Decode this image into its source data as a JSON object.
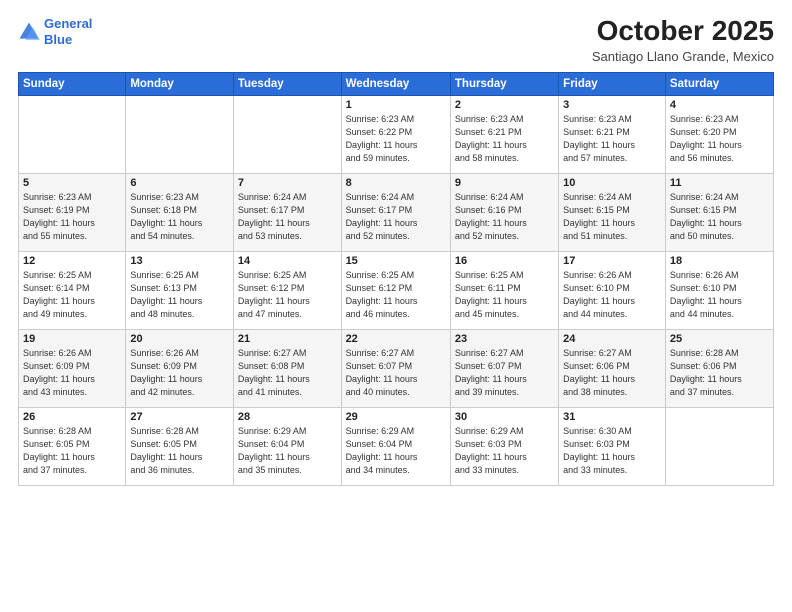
{
  "header": {
    "logo_line1": "General",
    "logo_line2": "Blue",
    "month_title": "October 2025",
    "location": "Santiago Llano Grande, Mexico"
  },
  "weekdays": [
    "Sunday",
    "Monday",
    "Tuesday",
    "Wednesday",
    "Thursday",
    "Friday",
    "Saturday"
  ],
  "weeks": [
    [
      {
        "day": "",
        "info": ""
      },
      {
        "day": "",
        "info": ""
      },
      {
        "day": "",
        "info": ""
      },
      {
        "day": "1",
        "info": "Sunrise: 6:23 AM\nSunset: 6:22 PM\nDaylight: 11 hours\nand 59 minutes."
      },
      {
        "day": "2",
        "info": "Sunrise: 6:23 AM\nSunset: 6:21 PM\nDaylight: 11 hours\nand 58 minutes."
      },
      {
        "day": "3",
        "info": "Sunrise: 6:23 AM\nSunset: 6:21 PM\nDaylight: 11 hours\nand 57 minutes."
      },
      {
        "day": "4",
        "info": "Sunrise: 6:23 AM\nSunset: 6:20 PM\nDaylight: 11 hours\nand 56 minutes."
      }
    ],
    [
      {
        "day": "5",
        "info": "Sunrise: 6:23 AM\nSunset: 6:19 PM\nDaylight: 11 hours\nand 55 minutes."
      },
      {
        "day": "6",
        "info": "Sunrise: 6:23 AM\nSunset: 6:18 PM\nDaylight: 11 hours\nand 54 minutes."
      },
      {
        "day": "7",
        "info": "Sunrise: 6:24 AM\nSunset: 6:17 PM\nDaylight: 11 hours\nand 53 minutes."
      },
      {
        "day": "8",
        "info": "Sunrise: 6:24 AM\nSunset: 6:17 PM\nDaylight: 11 hours\nand 52 minutes."
      },
      {
        "day": "9",
        "info": "Sunrise: 6:24 AM\nSunset: 6:16 PM\nDaylight: 11 hours\nand 52 minutes."
      },
      {
        "day": "10",
        "info": "Sunrise: 6:24 AM\nSunset: 6:15 PM\nDaylight: 11 hours\nand 51 minutes."
      },
      {
        "day": "11",
        "info": "Sunrise: 6:24 AM\nSunset: 6:15 PM\nDaylight: 11 hours\nand 50 minutes."
      }
    ],
    [
      {
        "day": "12",
        "info": "Sunrise: 6:25 AM\nSunset: 6:14 PM\nDaylight: 11 hours\nand 49 minutes."
      },
      {
        "day": "13",
        "info": "Sunrise: 6:25 AM\nSunset: 6:13 PM\nDaylight: 11 hours\nand 48 minutes."
      },
      {
        "day": "14",
        "info": "Sunrise: 6:25 AM\nSunset: 6:12 PM\nDaylight: 11 hours\nand 47 minutes."
      },
      {
        "day": "15",
        "info": "Sunrise: 6:25 AM\nSunset: 6:12 PM\nDaylight: 11 hours\nand 46 minutes."
      },
      {
        "day": "16",
        "info": "Sunrise: 6:25 AM\nSunset: 6:11 PM\nDaylight: 11 hours\nand 45 minutes."
      },
      {
        "day": "17",
        "info": "Sunrise: 6:26 AM\nSunset: 6:10 PM\nDaylight: 11 hours\nand 44 minutes."
      },
      {
        "day": "18",
        "info": "Sunrise: 6:26 AM\nSunset: 6:10 PM\nDaylight: 11 hours\nand 44 minutes."
      }
    ],
    [
      {
        "day": "19",
        "info": "Sunrise: 6:26 AM\nSunset: 6:09 PM\nDaylight: 11 hours\nand 43 minutes."
      },
      {
        "day": "20",
        "info": "Sunrise: 6:26 AM\nSunset: 6:09 PM\nDaylight: 11 hours\nand 42 minutes."
      },
      {
        "day": "21",
        "info": "Sunrise: 6:27 AM\nSunset: 6:08 PM\nDaylight: 11 hours\nand 41 minutes."
      },
      {
        "day": "22",
        "info": "Sunrise: 6:27 AM\nSunset: 6:07 PM\nDaylight: 11 hours\nand 40 minutes."
      },
      {
        "day": "23",
        "info": "Sunrise: 6:27 AM\nSunset: 6:07 PM\nDaylight: 11 hours\nand 39 minutes."
      },
      {
        "day": "24",
        "info": "Sunrise: 6:27 AM\nSunset: 6:06 PM\nDaylight: 11 hours\nand 38 minutes."
      },
      {
        "day": "25",
        "info": "Sunrise: 6:28 AM\nSunset: 6:06 PM\nDaylight: 11 hours\nand 37 minutes."
      }
    ],
    [
      {
        "day": "26",
        "info": "Sunrise: 6:28 AM\nSunset: 6:05 PM\nDaylight: 11 hours\nand 37 minutes."
      },
      {
        "day": "27",
        "info": "Sunrise: 6:28 AM\nSunset: 6:05 PM\nDaylight: 11 hours\nand 36 minutes."
      },
      {
        "day": "28",
        "info": "Sunrise: 6:29 AM\nSunset: 6:04 PM\nDaylight: 11 hours\nand 35 minutes."
      },
      {
        "day": "29",
        "info": "Sunrise: 6:29 AM\nSunset: 6:04 PM\nDaylight: 11 hours\nand 34 minutes."
      },
      {
        "day": "30",
        "info": "Sunrise: 6:29 AM\nSunset: 6:03 PM\nDaylight: 11 hours\nand 33 minutes."
      },
      {
        "day": "31",
        "info": "Sunrise: 6:30 AM\nSunset: 6:03 PM\nDaylight: 11 hours\nand 33 minutes."
      },
      {
        "day": "",
        "info": ""
      }
    ]
  ]
}
